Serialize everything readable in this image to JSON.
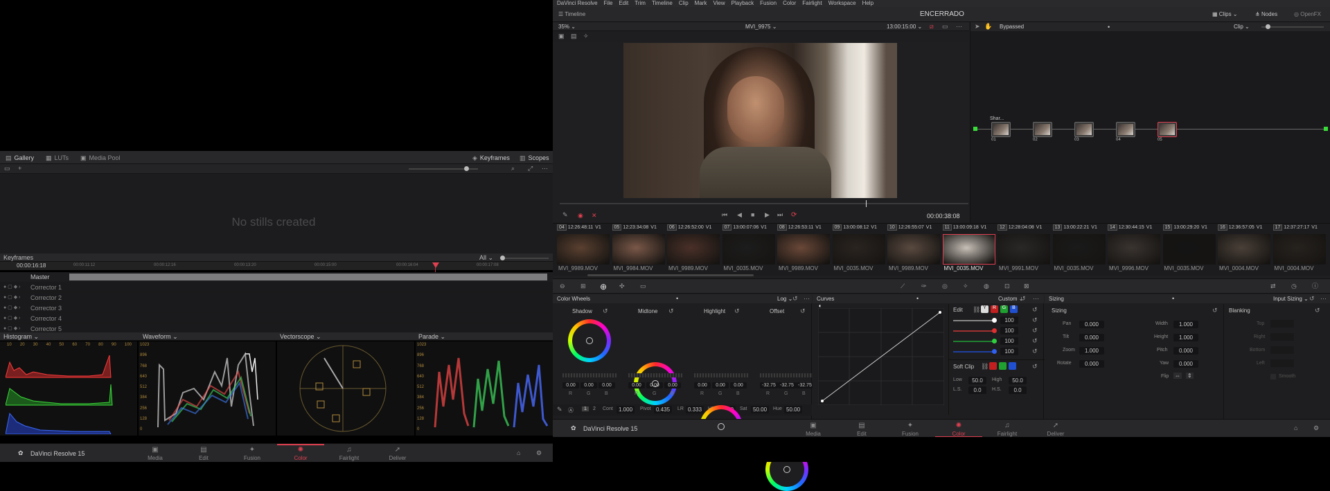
{
  "menu": {
    "items": [
      "DaVinci Resolve",
      "File",
      "Edit",
      "Trim",
      "Timeline",
      "Clip",
      "Mark",
      "View",
      "Playback",
      "Fusion",
      "Color",
      "Fairlight",
      "Workspace",
      "Help"
    ],
    "project_title": "ENCERRADO"
  },
  "viewer_header": {
    "timeline_label": "Timeline",
    "zoom": "35%",
    "clip_name": "MVI_9975",
    "timecode": "13:00:15:00",
    "clips_label": "Clips",
    "nodes_label": "Nodes",
    "openfx_label": "OpenFX"
  },
  "node_editor": {
    "status": "Bypassed",
    "mode": "Clip",
    "first_node_label": "Shar...",
    "nodes": [
      {
        "id": "01"
      },
      {
        "id": "02"
      },
      {
        "id": "03"
      },
      {
        "id": "04"
      },
      {
        "id": "05"
      }
    ]
  },
  "transport": {
    "timecode": "00:00:38:08"
  },
  "clips": [
    {
      "num": "04",
      "tc": "12:26:48:11",
      "track": "V1",
      "name": "MVI_9989.MOV"
    },
    {
      "num": "05",
      "tc": "12:23:34:08",
      "track": "V1",
      "name": "MVI_9984.MOV"
    },
    {
      "num": "06",
      "tc": "12:26:52:00",
      "track": "V1",
      "name": "MVI_9989.MOV"
    },
    {
      "num": "07",
      "tc": "13:00:07:06",
      "track": "V1",
      "name": "MVI_0035.MOV"
    },
    {
      "num": "08",
      "tc": "12:26:53:11",
      "track": "V1",
      "name": "MVI_9989.MOV"
    },
    {
      "num": "09",
      "tc": "13:00:08:12",
      "track": "V1",
      "name": "MVI_0035.MOV"
    },
    {
      "num": "10",
      "tc": "12:26:55:07",
      "track": "V1",
      "name": "MVI_9989.MOV"
    },
    {
      "num": "11",
      "tc": "13:00:09:18",
      "track": "V1",
      "name": "MVI_0035.MOV"
    },
    {
      "num": "12",
      "tc": "12:28:04:08",
      "track": "V1",
      "name": "MVI_9991.MOV"
    },
    {
      "num": "13",
      "tc": "13:00:22:21",
      "track": "V1",
      "name": "MVI_0035.MOV"
    },
    {
      "num": "14",
      "tc": "12:30:44:15",
      "track": "V1",
      "name": "MVI_9996.MOV"
    },
    {
      "num": "15",
      "tc": "13:00:29:20",
      "track": "V1",
      "name": "MVI_0035.MOV"
    },
    {
      "num": "16",
      "tc": "12:36:57:05",
      "track": "V1",
      "name": "MVI_0004.MOV"
    },
    {
      "num": "17",
      "tc": "12:37:27:17",
      "track": "V1",
      "name": "MVI_0004.MOV"
    }
  ],
  "color_wheels": {
    "title": "Color Wheels",
    "mode": "Log",
    "wheels": [
      {
        "name": "Shadow",
        "r": "0.00",
        "g": "0.00",
        "b": "0.00"
      },
      {
        "name": "Midtone",
        "r": "0.00",
        "g": "0.00",
        "b": "0.00"
      },
      {
        "name": "Highlight",
        "r": "0.00",
        "g": "0.00",
        "b": "0.00"
      },
      {
        "name": "Offset",
        "r": "-32.75",
        "g": "-32.75",
        "b": "-32.75"
      }
    ],
    "rgb_labels": [
      "R",
      "G",
      "B"
    ],
    "page1": "1",
    "page2": "2",
    "cont_label": "Cont",
    "cont": "1.000",
    "pivot_label": "Pivot",
    "pivot": "0.435",
    "lr_label": "LR",
    "lr": "0.333",
    "hr_label": "HR",
    "hr": "0.550",
    "sat_label": "Sat",
    "sat": "50.00",
    "hue_label": "Hue",
    "hue": "50.00"
  },
  "curves": {
    "title": "Curves",
    "mode": "Custom",
    "edit_label": "Edit",
    "channels": [
      "Y",
      "R",
      "G",
      "B"
    ],
    "values": [
      "100",
      "100",
      "100",
      "100"
    ],
    "soft_clip_label": "Soft Clip",
    "low_label": "Low",
    "low": "50.0",
    "high_label": "High",
    "high": "50.0",
    "ls_label": "L.S.",
    "ls": "0.0",
    "hs_label": "H.S.",
    "hs": "0.0"
  },
  "sizing": {
    "title": "Sizing",
    "mode": "Input Sizing",
    "section": "Sizing",
    "blanking_label": "Blanking",
    "left_fields": [
      {
        "label": "Pan",
        "value": "0.000"
      },
      {
        "label": "Tilt",
        "value": "0.000"
      },
      {
        "label": "Zoom",
        "value": "1.000"
      },
      {
        "label": "Rotate",
        "value": "0.000"
      }
    ],
    "right_fields": [
      {
        "label": "Width",
        "value": "1.000"
      },
      {
        "label": "Height",
        "value": "1.000"
      },
      {
        "label": "Pitch",
        "value": "0.000"
      },
      {
        "label": "Yaw",
        "value": "0.000"
      }
    ],
    "flip_label": "Flip",
    "blank_fields": [
      "Top",
      "Right",
      "Bottom",
      "Left"
    ],
    "smooth_label": "Smooth"
  },
  "gallery": {
    "tabs": [
      "Gallery",
      "LUTs",
      "Media Pool"
    ],
    "keyframes_tab": "Keyframes",
    "scopes_tab": "Scopes",
    "empty_text": "No stills created"
  },
  "keyframes": {
    "title": "Keyframes",
    "filter": "All",
    "current_tc": "00:00:16:18",
    "ruler": [
      "00:00:11:12",
      "00:00:12:16",
      "00:00:13:20",
      "00:00:15:00",
      "00:00:16:04",
      "00:00:17:08"
    ],
    "master_label": "Master",
    "tracks": [
      "Corrector 1",
      "Corrector 2",
      "Corrector 3",
      "Corrector 4",
      "Corrector 5"
    ]
  },
  "scopes": {
    "histogram_label": "Histogram",
    "waveform_label": "Waveform",
    "vectorscope_label": "Vectorscope",
    "parade_label": "Parade",
    "histogram_ticks": [
      "10",
      "20",
      "30",
      "40",
      "50",
      "60",
      "70",
      "80",
      "90",
      "100"
    ],
    "wave_ticks": [
      "1023",
      "896",
      "768",
      "640",
      "512",
      "384",
      "256",
      "128",
      "0"
    ]
  },
  "footer": {
    "app_name": "DaVinci Resolve 15",
    "pages": [
      "Media",
      "Edit",
      "Fusion",
      "Color",
      "Fairlight",
      "Deliver"
    ],
    "active_page": "Color"
  },
  "colors": {
    "accent": "#e04050",
    "panel": "#28282b",
    "background": "#1f1f21"
  }
}
